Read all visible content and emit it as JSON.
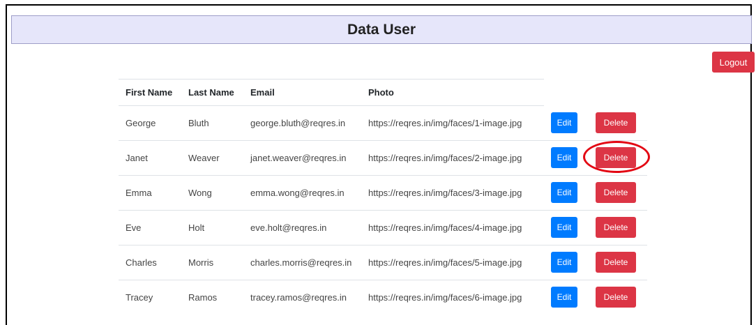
{
  "header": {
    "title": "Data User"
  },
  "actions": {
    "logout_label": "Logout"
  },
  "table": {
    "headers": [
      "First Name",
      "Last Name",
      "Email",
      "Photo"
    ],
    "edit_label": "Edit",
    "delete_label": "Delete",
    "rows": [
      {
        "first_name": "George",
        "last_name": "Bluth",
        "email": "george.bluth@reqres.in",
        "photo": "https://reqres.in/img/faces/1-image.jpg",
        "highlighted": false
      },
      {
        "first_name": "Janet",
        "last_name": "Weaver",
        "email": "janet.weaver@reqres.in",
        "photo": "https://reqres.in/img/faces/2-image.jpg",
        "highlighted": true
      },
      {
        "first_name": "Emma",
        "last_name": "Wong",
        "email": "emma.wong@reqres.in",
        "photo": "https://reqres.in/img/faces/3-image.jpg",
        "highlighted": false
      },
      {
        "first_name": "Eve",
        "last_name": "Holt",
        "email": "eve.holt@reqres.in",
        "photo": "https://reqres.in/img/faces/4-image.jpg",
        "highlighted": false
      },
      {
        "first_name": "Charles",
        "last_name": "Morris",
        "email": "charles.morris@reqres.in",
        "photo": "https://reqres.in/img/faces/5-image.jpg",
        "highlighted": false
      },
      {
        "first_name": "Tracey",
        "last_name": "Ramos",
        "email": "tracey.ramos@reqres.in",
        "photo": "https://reqres.in/img/faces/6-image.jpg",
        "highlighted": false
      }
    ]
  },
  "colors": {
    "header_bg": "#e6e6fa",
    "primary": "#007bff",
    "danger": "#dc3545",
    "annotation": "#e30613"
  }
}
